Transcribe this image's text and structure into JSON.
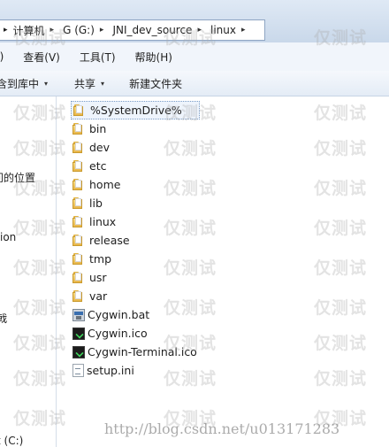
{
  "address_bar": {
    "crumbs": [
      {
        "label": "计算机"
      },
      {
        "label": "G (G:)"
      },
      {
        "label": "JNI_dev_source"
      },
      {
        "label": "linux"
      }
    ],
    "lead_arrow": "▸"
  },
  "menu": {
    "items": [
      {
        "label": "E)"
      },
      {
        "label": "查看(V)"
      },
      {
        "label": "工具(T)"
      },
      {
        "label": "帮助(H)"
      }
    ]
  },
  "toolbar": {
    "include_label": "含到库中",
    "share_label": "共享",
    "new_folder_label": "新建文件夹",
    "dropdown_glyph": "▾"
  },
  "nav_pane": {
    "items": [
      {
        "label": "问的位置"
      },
      {
        "label": "ion"
      },
      {
        "label": "戟"
      },
      {
        "label": "t (C:)"
      }
    ]
  },
  "files": [
    {
      "name": "%SystemDrive%",
      "type": "folder",
      "selected": true
    },
    {
      "name": "bin",
      "type": "folder"
    },
    {
      "name": "dev",
      "type": "folder"
    },
    {
      "name": "etc",
      "type": "folder"
    },
    {
      "name": "home",
      "type": "folder"
    },
    {
      "name": "lib",
      "type": "folder"
    },
    {
      "name": "linux",
      "type": "folder"
    },
    {
      "name": "release",
      "type": "folder"
    },
    {
      "name": "tmp",
      "type": "folder"
    },
    {
      "name": "usr",
      "type": "folder"
    },
    {
      "name": "var",
      "type": "folder"
    },
    {
      "name": "Cygwin.bat",
      "type": "bat"
    },
    {
      "name": "Cygwin.ico",
      "type": "ico"
    },
    {
      "name": "Cygwin-Terminal.ico",
      "type": "ico"
    },
    {
      "name": "setup.ini",
      "type": "ini"
    }
  ],
  "watermark": {
    "text": "仅测试",
    "credit": "http://blog.csdn.net/u013171283"
  },
  "colors": {
    "address_bar_bg": "#dfe9f5",
    "menubar_bg": "#f1f5fb",
    "folder_yellow": "#f9dc83",
    "selection_border": "#7a9cc6"
  }
}
